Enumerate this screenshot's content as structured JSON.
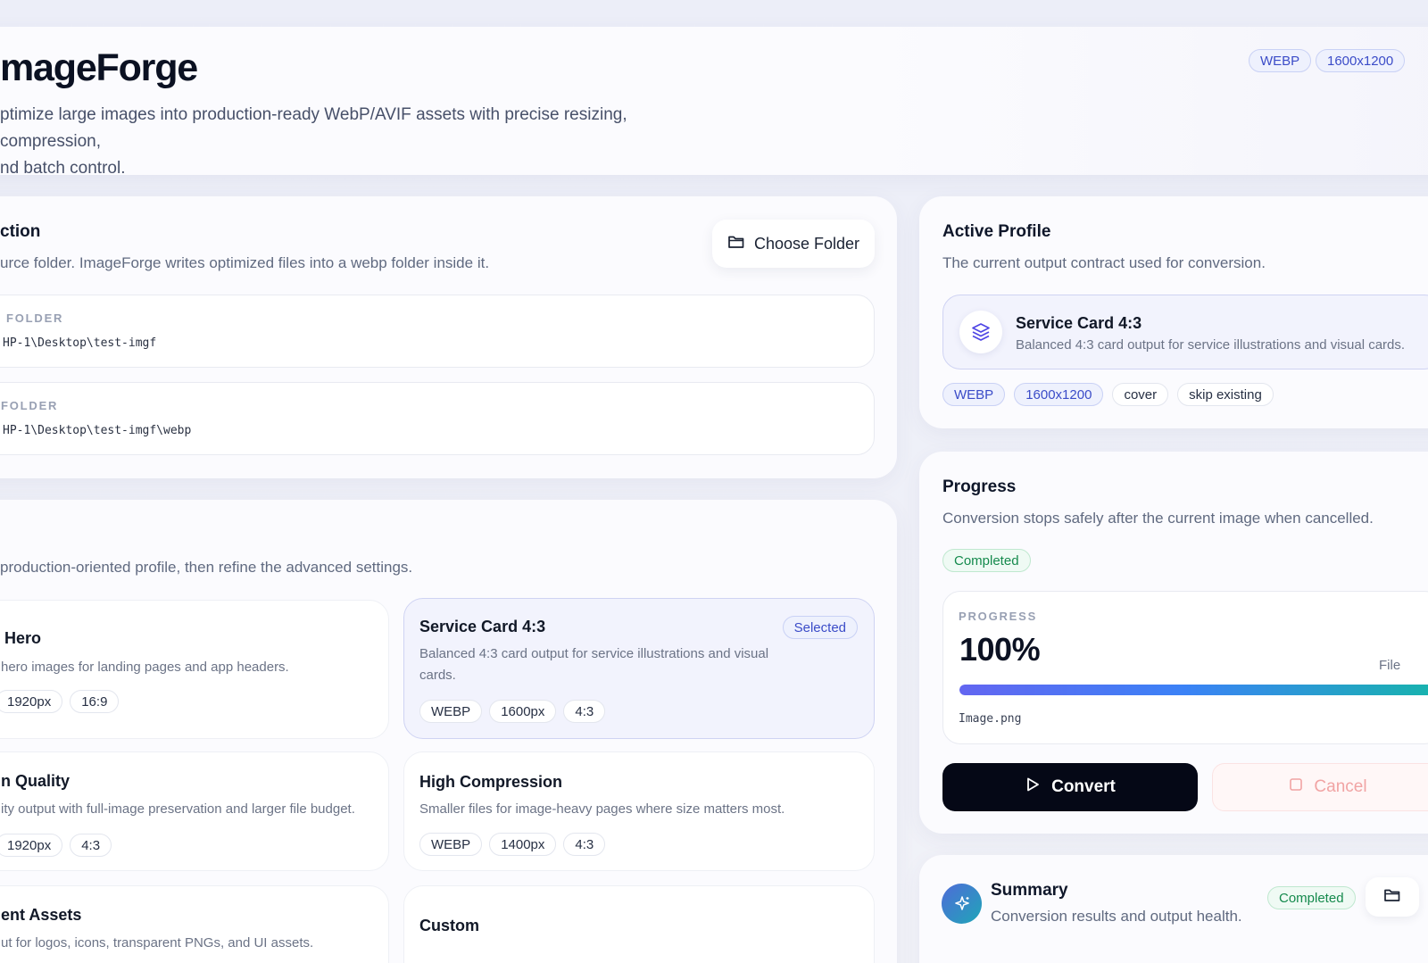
{
  "header": {
    "title": "mageForge",
    "subtitle": "ptimize large images into production-ready WebP/AVIF assets with precise resizing, compression, nd batch control.",
    "format_tag": "WEBP",
    "size_tag": "1600x1200"
  },
  "selection": {
    "title": "ction",
    "description": "urce folder. ImageForge writes optimized files into a webp folder inside it.",
    "choose_button": "Choose Folder",
    "source_label": "FOLDER",
    "source_path": "HP-1\\Desktop\\test-imgf",
    "output_label": "FOLDER",
    "output_path": "HP-1\\Desktop\\test-imgf\\webp"
  },
  "profiles": {
    "description": "production-oriented profile, then refine the advanced settings.",
    "items": [
      {
        "title": "Hero",
        "desc": "hero images for landing pages and app headers.",
        "tags": [
          "1920px",
          "16:9"
        ]
      },
      {
        "title": "Service Card 4:3",
        "desc": "Balanced 4:3 card output for service illustrations and visual cards.",
        "tags": [
          "WEBP",
          "1600px",
          "4:3"
        ],
        "badge": "Selected"
      },
      {
        "title": "n Quality",
        "desc": "ity output with full-image preservation and larger file budget.",
        "tags": [
          "1920px",
          "4:3"
        ]
      },
      {
        "title": "High Compression",
        "desc": "Smaller files for image-heavy pages where size matters most.",
        "tags": [
          "WEBP",
          "1400px",
          "4:3"
        ]
      },
      {
        "title": "ent Assets",
        "desc": "ut for logos, icons, transparent PNGs, and UI assets.",
        "tags": []
      },
      {
        "title": "Custom",
        "desc": "",
        "tags": []
      }
    ]
  },
  "active_profile": {
    "title": "Active Profile",
    "description": "The current output contract used for conversion.",
    "name": "Service Card 4:3",
    "detail": "Balanced 4:3 card output for service illustrations and visual cards.",
    "tags": [
      "WEBP",
      "1600x1200",
      "cover",
      "skip existing"
    ]
  },
  "progress": {
    "title": "Progress",
    "description": "Conversion stops safely after the current image when cancelled.",
    "status": "Completed",
    "label": "PROGRESS",
    "percent_text": "100%",
    "percent": 100,
    "files_label": "File",
    "current_file": "Image.png",
    "convert_button": "Convert",
    "cancel_button": "Cancel"
  },
  "summary": {
    "title": "Summary",
    "description": "Conversion results and output health.",
    "status": "Completed"
  },
  "icons": {
    "folder": "folder-icon",
    "layers": "layers-icon",
    "play": "play-icon",
    "stop": "stop-icon",
    "sparkle": "sparkle-icon"
  },
  "colors": {
    "accent": "#6366f1",
    "success": "#158a4d",
    "dark": "#050816",
    "danger_soft": "#f1a4a4"
  }
}
